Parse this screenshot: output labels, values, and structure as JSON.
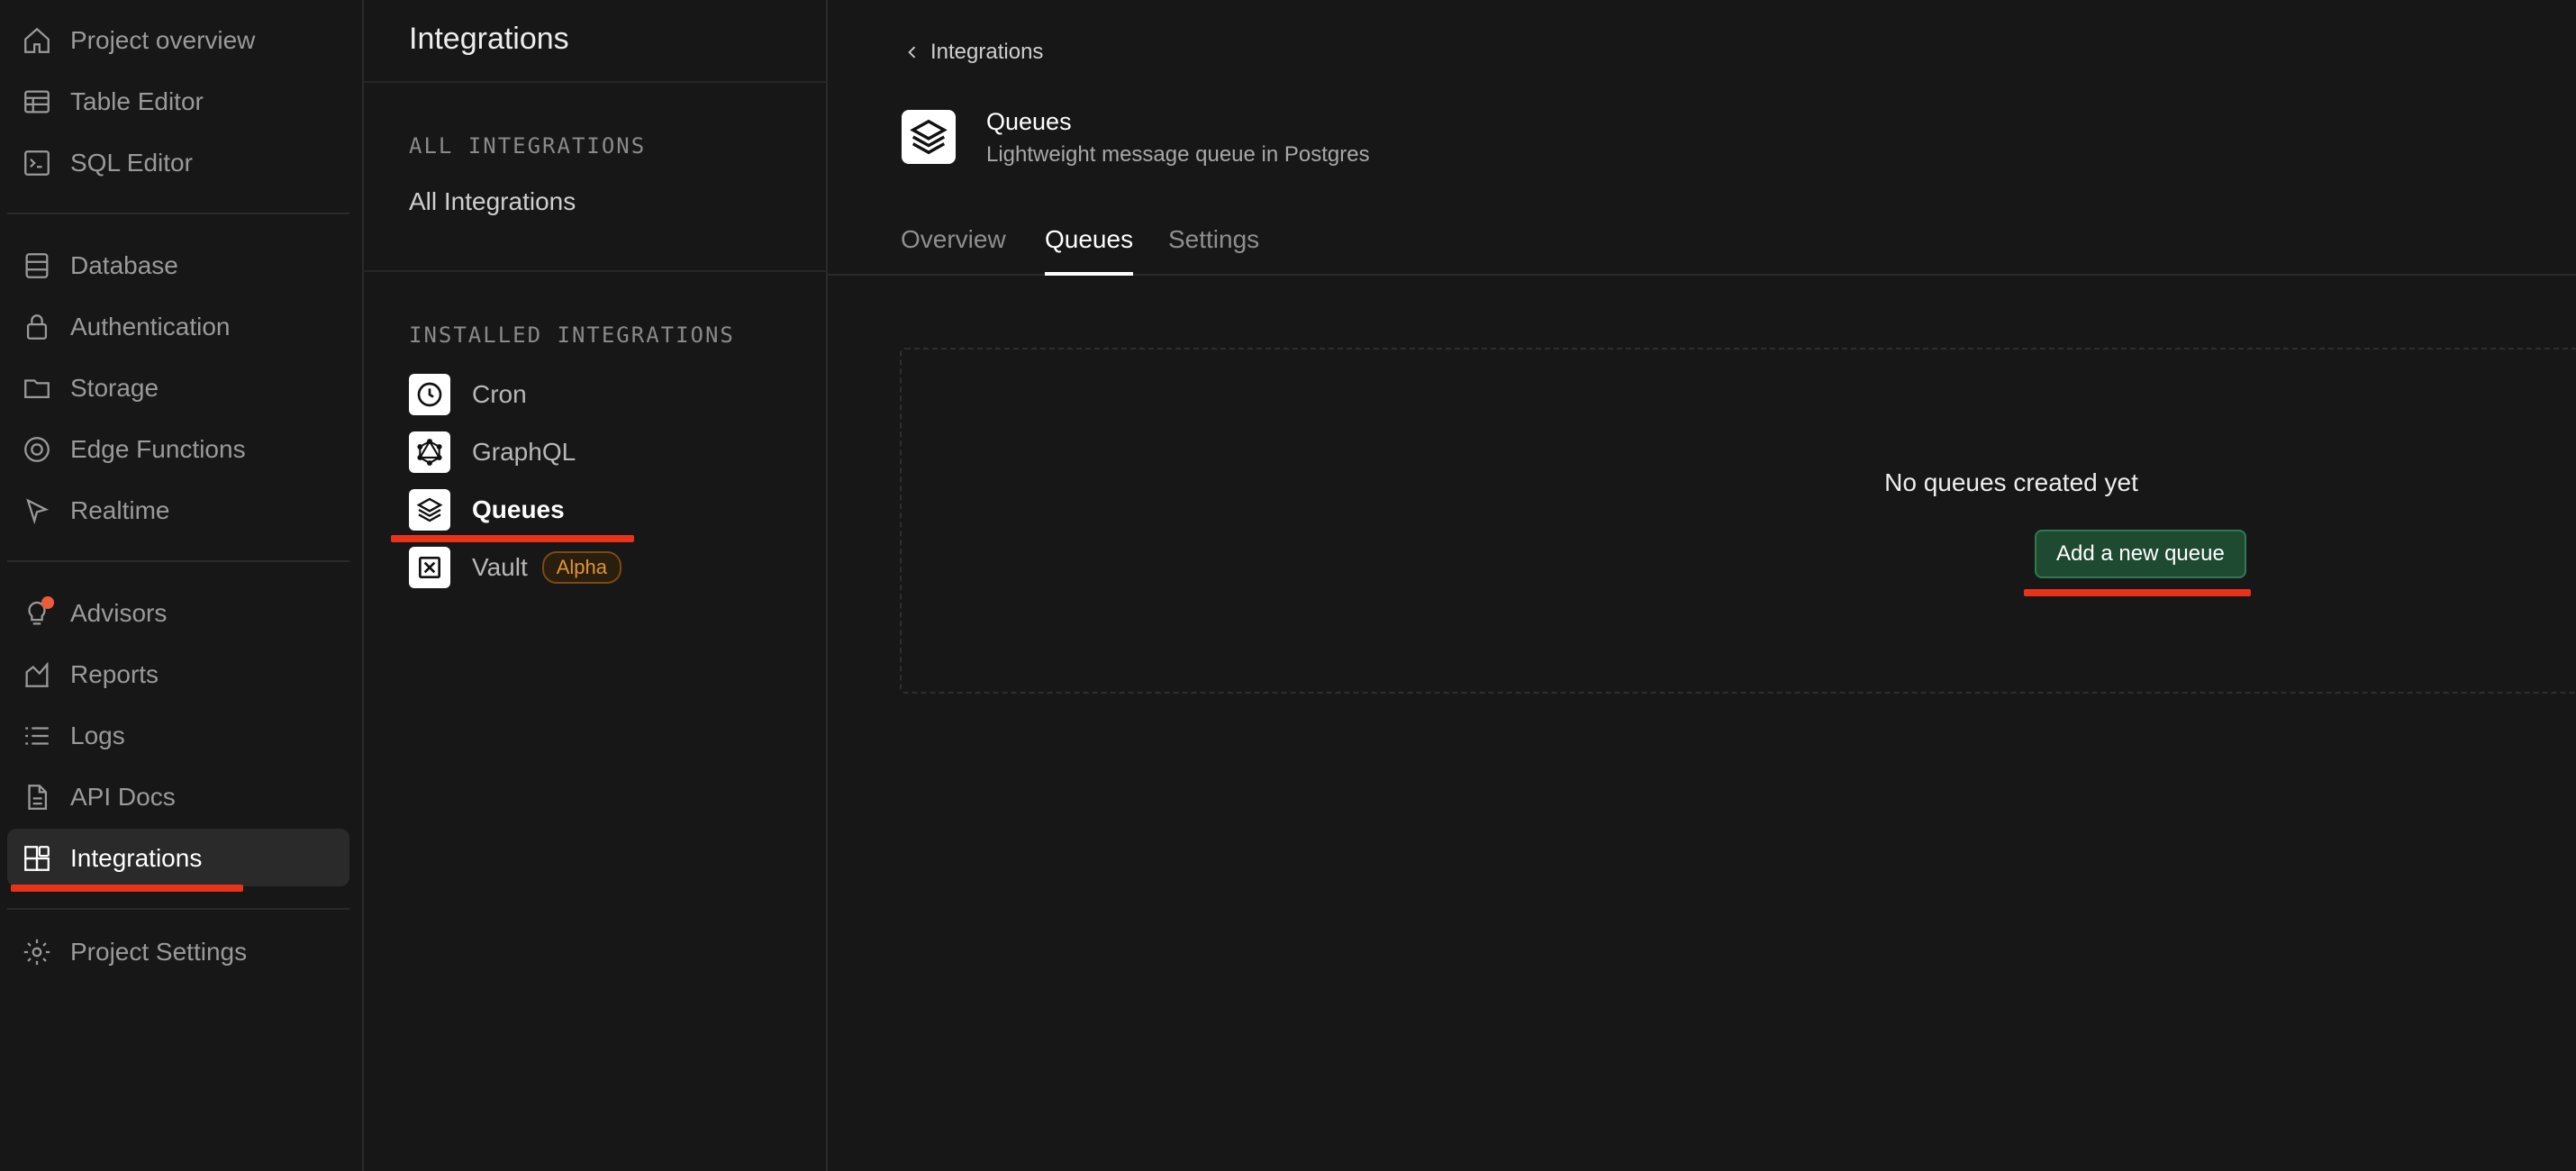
{
  "nav": {
    "items": [
      {
        "label": "Project overview",
        "icon": "home-icon"
      },
      {
        "label": "Table Editor",
        "icon": "table-icon"
      },
      {
        "label": "SQL Editor",
        "icon": "terminal-icon"
      },
      {
        "label": "Database",
        "icon": "database-icon"
      },
      {
        "label": "Authentication",
        "icon": "lock-icon"
      },
      {
        "label": "Storage",
        "icon": "folder-icon"
      },
      {
        "label": "Edge Functions",
        "icon": "globe-icon"
      },
      {
        "label": "Realtime",
        "icon": "cursor-icon"
      },
      {
        "label": "Advisors",
        "icon": "lightbulb-icon"
      },
      {
        "label": "Reports",
        "icon": "chart-icon"
      },
      {
        "label": "Logs",
        "icon": "list-icon"
      },
      {
        "label": "API Docs",
        "icon": "document-icon"
      },
      {
        "label": "Integrations",
        "icon": "blocks-icon",
        "active": true
      },
      {
        "label": "Project Settings",
        "icon": "gear-icon"
      }
    ]
  },
  "subpanel": {
    "title": "Integrations",
    "all_section": "ALL INTEGRATIONS",
    "all_link": "All Integrations",
    "installed_section": "INSTALLED INTEGRATIONS",
    "installed": [
      {
        "label": "Cron",
        "icon": "clock-icon"
      },
      {
        "label": "GraphQL",
        "icon": "graphql-icon"
      },
      {
        "label": "Queues",
        "icon": "layers-icon",
        "active": true
      },
      {
        "label": "Vault",
        "icon": "vault-icon",
        "badge": "Alpha"
      }
    ]
  },
  "main": {
    "breadcrumb": "Integrations",
    "title": "Queues",
    "subtitle": "Lightweight message queue in Postgres",
    "tabs": [
      {
        "label": "Overview"
      },
      {
        "label": "Queues",
        "active": true
      },
      {
        "label": "Settings"
      }
    ],
    "empty_text": "No queues created yet",
    "add_button": "Add a new queue"
  },
  "colors": {
    "background": "#171717",
    "accent_green": "#1f4a32",
    "annotation_red": "#e8321a",
    "badge_orange": "#e09530"
  }
}
